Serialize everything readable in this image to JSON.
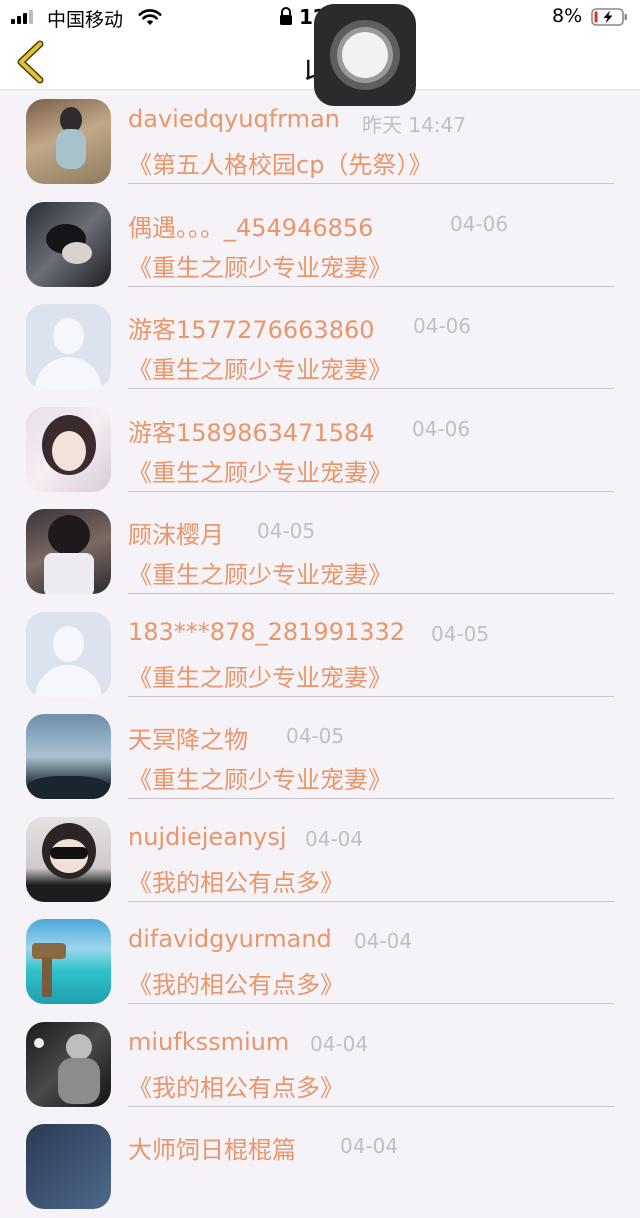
{
  "status_bar": {
    "carrier": "中国移动",
    "time": "12",
    "battery_percent": "8%",
    "icons": [
      "signal-icon",
      "wifi-icon",
      "lock-icon",
      "battery-charging-icon"
    ]
  },
  "nav": {
    "title": "收",
    "back_icon": "chevron-left-icon"
  },
  "colors": {
    "accent": "#e8966a",
    "date": "#c2bec4",
    "back_chevron": "#e4c233"
  },
  "items": [
    {
      "user": "daviedqyuqfrman",
      "date": "昨天 14:47",
      "book": "《第五人格校园cp（先祭）》"
    },
    {
      "user": "偶遇。。。_454946856",
      "date": "04-06",
      "book": "《重生之顾少专业宠妻》"
    },
    {
      "user": "游客1577276663860",
      "date": "04-06",
      "book": "《重生之顾少专业宠妻》"
    },
    {
      "user": "游客1589863471584",
      "date": "04-06",
      "book": "《重生之顾少专业宠妻》"
    },
    {
      "user": "顾沫樱月",
      "date": "04-05",
      "book": "《重生之顾少专业宠妻》"
    },
    {
      "user": "183***878_281991332",
      "date": "04-05",
      "book": "《重生之顾少专业宠妻》"
    },
    {
      "user": "天冥降之物",
      "date": "04-05",
      "book": "《重生之顾少专业宠妻》"
    },
    {
      "user": "nujdiejeanysj",
      "date": "04-04",
      "book": "《我的相公有点多》"
    },
    {
      "user": "difavidgyurmand",
      "date": "04-04",
      "book": "《我的相公有点多》"
    },
    {
      "user": "miufkssmium",
      "date": "04-04",
      "book": "《我的相公有点多》"
    },
    {
      "user": "大师饲日棍棍篇",
      "date": "04-04",
      "book": ""
    }
  ]
}
